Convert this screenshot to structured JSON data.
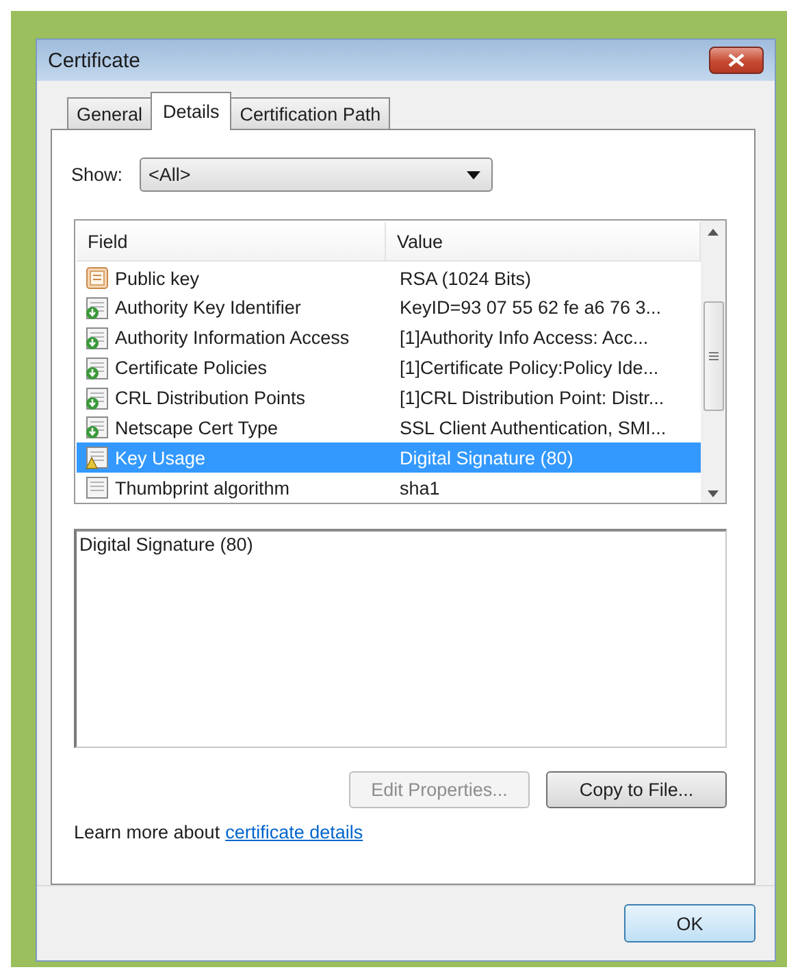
{
  "window": {
    "title": "Certificate"
  },
  "tabs": [
    {
      "label": "General",
      "selected": false
    },
    {
      "label": "Details",
      "selected": true
    },
    {
      "label": "Certification Path",
      "selected": false
    }
  ],
  "show": {
    "label": "Show:",
    "value": "<All>"
  },
  "table": {
    "columns": [
      "Field",
      "Value"
    ],
    "rows": [
      {
        "kind": "key",
        "field": "Public key",
        "value": "RSA (1024 Bits)",
        "selected": false
      },
      {
        "kind": "extension",
        "field": "Authority Key Identifier",
        "value": "KeyID=93 07 55 62 fe a6 76 3...",
        "selected": false
      },
      {
        "kind": "extension",
        "field": "Authority Information Access",
        "value": "[1]Authority Info Access: Acc...",
        "selected": false
      },
      {
        "kind": "extension",
        "field": "Certificate Policies",
        "value": "[1]Certificate Policy:Policy Ide...",
        "selected": false
      },
      {
        "kind": "extension",
        "field": "CRL Distribution Points",
        "value": "[1]CRL Distribution Point: Distr...",
        "selected": false
      },
      {
        "kind": "extension",
        "field": "Netscape Cert Type",
        "value": "SSL Client Authentication, SMI...",
        "selected": false
      },
      {
        "kind": "critical",
        "field": "Key Usage",
        "value": "Digital Signature (80)",
        "selected": true
      },
      {
        "kind": "property",
        "field": "Thumbprint algorithm",
        "value": "sha1",
        "selected": false
      }
    ]
  },
  "detail": {
    "value": "Digital Signature (80)"
  },
  "buttons": [
    {
      "label": "Edit Properties...",
      "disabled": true
    },
    {
      "label": "Copy to File...",
      "disabled": false
    }
  ],
  "learn_more": {
    "text": "Learn more about",
    "link": "certificate details"
  },
  "ok_button": {
    "label": "OK"
  }
}
